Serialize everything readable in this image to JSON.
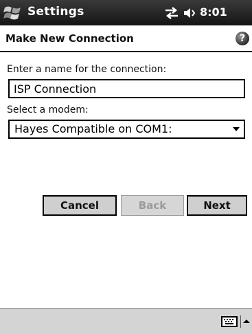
{
  "titlebar": {
    "app_title": "Settings",
    "time": "8:01",
    "icons": {
      "start": "windows-start-icon",
      "connectivity": "connectivity-arrows-icon",
      "volume": "speaker-icon"
    }
  },
  "header": {
    "title": "Make New Connection",
    "help_icon": "help-icon",
    "help_glyph": "?"
  },
  "form": {
    "name_label": "Enter a name for the connection:",
    "name_value": "ISP Connection",
    "modem_label": "Select a modem:",
    "modem_value": "Hayes Compatible on COM1:"
  },
  "buttons": {
    "cancel": "Cancel",
    "back": "Back",
    "next": "Next",
    "back_disabled": true
  },
  "bottombar": {
    "keyboard_icon": "keyboard-icon",
    "sip_arrow_icon": "chevron-up-icon"
  },
  "colors": {
    "titlebar": "#1c1c1c",
    "bottombar": "#d4d4d4",
    "button_face": "#cfcfcf",
    "disabled_text": "#9a9a9a"
  }
}
